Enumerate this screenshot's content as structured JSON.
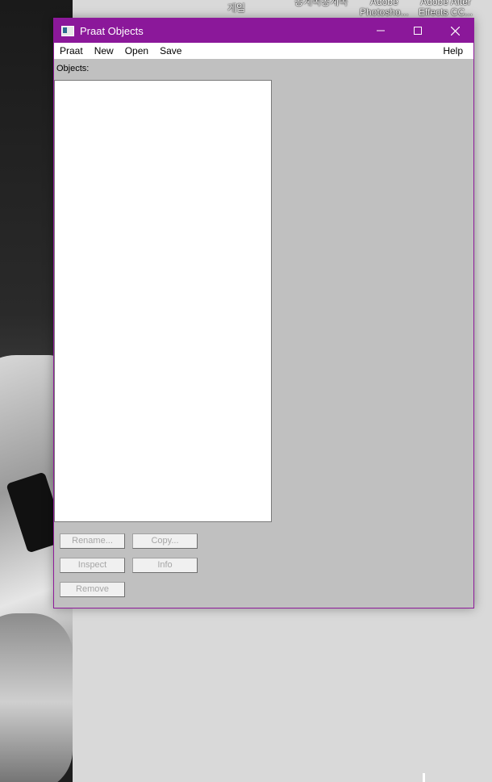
{
  "desktop": {
    "icon_labels": [
      {
        "line1": "게임",
        "line2": ""
      },
      {
        "line1": "공계속공계속",
        "line2": ""
      },
      {
        "line1": "Adobe",
        "line2": "Photosho..."
      },
      {
        "line1": "Adobe After",
        "line2": "Effects CC..."
      }
    ]
  },
  "window": {
    "title": "Praat Objects",
    "controls": {
      "minimize_icon": "minimize-icon",
      "maximize_icon": "maximize-icon",
      "close_icon": "close-icon"
    },
    "accent_color": "#8b189a"
  },
  "menubar": {
    "items": [
      "Praat",
      "New",
      "Open",
      "Save"
    ],
    "help": "Help"
  },
  "objects": {
    "label": "Objects:",
    "items": []
  },
  "buttons": {
    "rename": "Rename...",
    "copy": "Copy...",
    "inspect": "Inspect",
    "info": "Info",
    "remove": "Remove"
  }
}
